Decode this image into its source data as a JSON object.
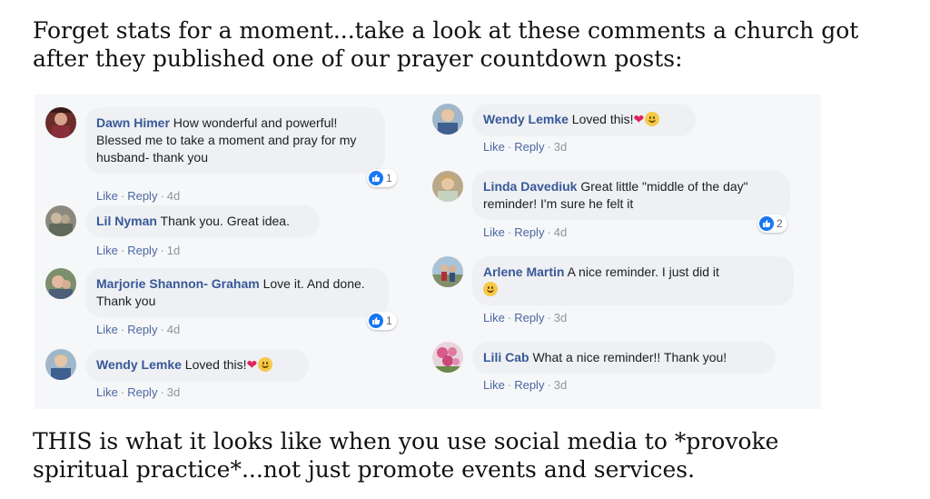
{
  "headline": {
    "line1": "Forget stats for a moment...take a look at these comments a church got",
    "line2": "after they published one of our prayer countdown posts:"
  },
  "footer": {
    "line1": "THIS is what it looks like when you use social media to *provoke",
    "line2": "spiritual practice*...not just promote events and services."
  },
  "actions": {
    "like": "Like",
    "reply": "Reply",
    "separator": "·"
  },
  "comments": [
    {
      "author": "Dawn Himer",
      "text": " How wonderful and powerful! Blessed me to take a moment and pray for my husband- thank you",
      "time": "4d",
      "reactions": "1"
    },
    {
      "author": "Lil Nyman",
      "text": " Thank you. Great idea.",
      "time": "1d"
    },
    {
      "author": "Marjorie Shannon- Graham",
      "text": " Love it. And done. Thank you",
      "time": "4d",
      "reactions": "1"
    },
    {
      "author": "Wendy Lemke",
      "text": " Loved this!",
      "time": "3d"
    },
    {
      "author": "Wendy Lemke",
      "text": " Loved this!",
      "time": "3d"
    },
    {
      "author": "Linda Davediuk",
      "text": " Great little \"middle of the day\" reminder! I'm sure he felt it",
      "time": "4d",
      "reactions": "2"
    },
    {
      "author": "Arlene Martin",
      "text": " A nice reminder. I just did it",
      "time": "3d"
    },
    {
      "author": "Lili Cab",
      "text": " What a nice reminder!! Thank you!",
      "time": "3d"
    }
  ],
  "emoji": {
    "heart": "❤",
    "smile": "smile-emoji"
  },
  "colors": {
    "author_link": "#385898",
    "bubble": "#eef0f3",
    "like_blue": "#1877f2",
    "panel": "#f6f7f9"
  }
}
